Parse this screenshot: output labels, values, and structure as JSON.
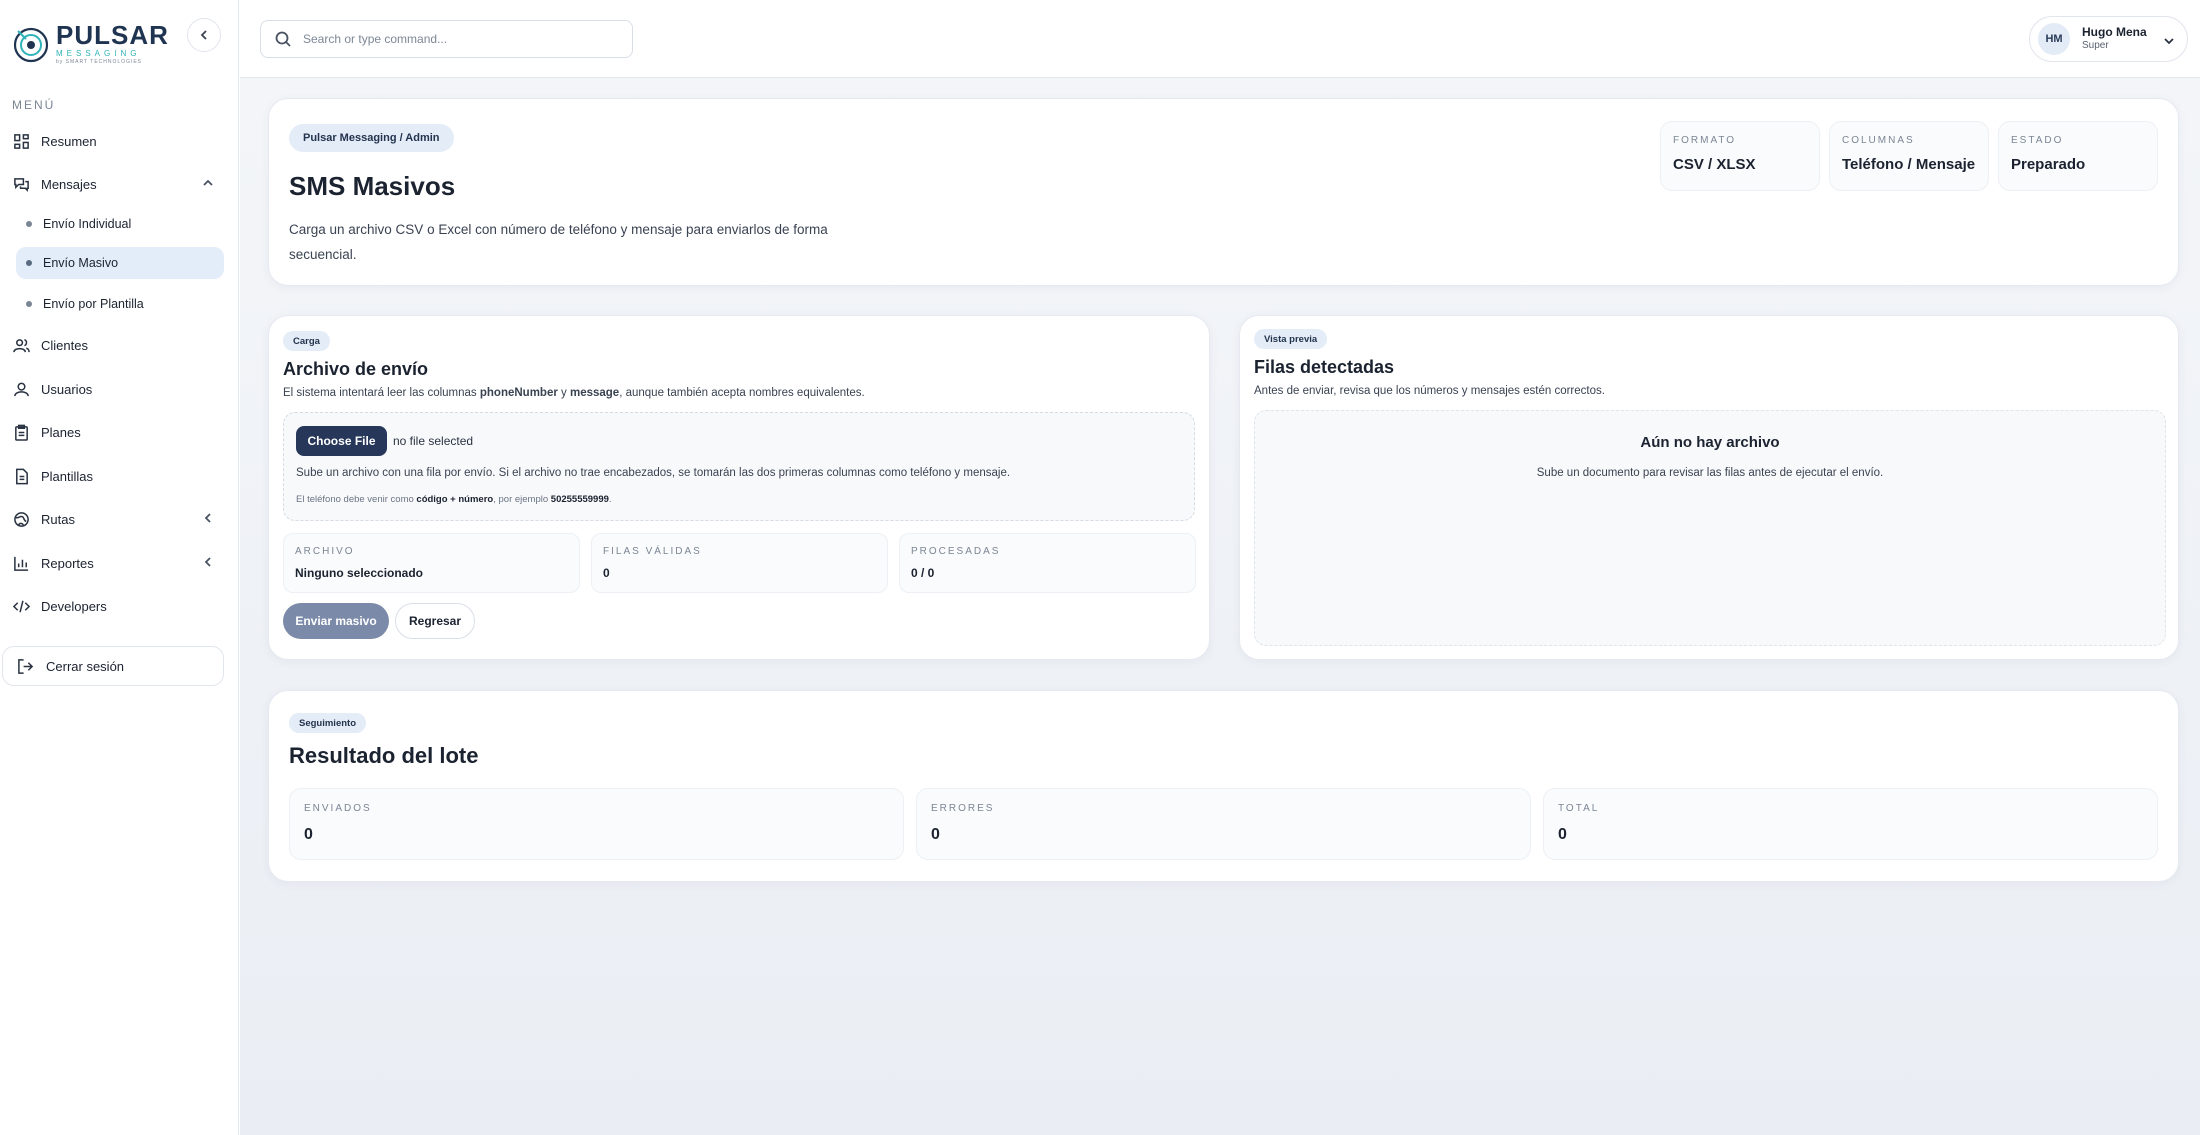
{
  "brand": {
    "name": "PULSAR",
    "sub": "MESSAGING",
    "sub2": "by SMART TECHNOLOGIES"
  },
  "sidebar": {
    "menu_label": "MENÚ",
    "items": [
      {
        "label": "Resumen",
        "icon": "grid-icon"
      },
      {
        "label": "Mensajes",
        "icon": "messages-icon"
      },
      {
        "label": "Clientes",
        "icon": "users-icon"
      },
      {
        "label": "Usuarios",
        "icon": "user-icon"
      },
      {
        "label": "Planes",
        "icon": "clipboard-icon"
      },
      {
        "label": "Plantillas",
        "icon": "document-icon"
      },
      {
        "label": "Rutas",
        "icon": "globe-icon"
      },
      {
        "label": "Reportes",
        "icon": "bar-chart-icon"
      },
      {
        "label": "Developers",
        "icon": "code-icon"
      }
    ],
    "subitems": [
      {
        "label": "Envío Individual"
      },
      {
        "label": "Envío Masivo"
      },
      {
        "label": "Envío por Plantilla"
      }
    ],
    "logout": "Cerrar sesión"
  },
  "topbar": {
    "search_placeholder": "Search or type command...",
    "user": {
      "initials": "HM",
      "name": "Hugo Mena",
      "role": "Super"
    }
  },
  "hero": {
    "breadcrumb": "Pulsar Messaging / Admin",
    "title": "SMS Masivos",
    "description_line1": "Carga un archivo CSV o Excel con número de teléfono y mensaje para enviarlos de forma",
    "description_line2": "secuencial.",
    "stats": [
      {
        "label": "FORMATO",
        "value": "CSV / XLSX"
      },
      {
        "label": "COLUMNAS",
        "value": "Teléfono / Mensaje"
      },
      {
        "label": "ESTADO",
        "value": "Preparado"
      }
    ]
  },
  "upload_card": {
    "tag": "Carga",
    "title": "Archivo de envío",
    "desc_a": "El sistema intentará leer las columnas ",
    "desc_b": "phoneNumber",
    "desc_c": " y ",
    "desc_d": "message",
    "desc_e": ", aunque también acepta nombres equivalentes.",
    "choose_file": "Choose File",
    "no_file": "no file selected",
    "hint1": "Sube un archivo con una fila por envío. Si el archivo no trae encabezados, se tomarán las dos primeras columnas como teléfono y mensaje.",
    "hint2_a": "El teléfono debe venir como ",
    "hint2_b": "código + número",
    "hint2_c": ", por ejemplo ",
    "hint2_d": "50255559999",
    "hint2_e": ".",
    "fields": [
      {
        "label": "ARCHIVO",
        "value": "Ninguno seleccionado"
      },
      {
        "label": "FILAS VÁLIDAS",
        "value": "0"
      },
      {
        "label": "PROCESADAS",
        "value": "0 / 0"
      }
    ],
    "send_button": "Enviar masivo",
    "back_button": "Regresar"
  },
  "preview_card": {
    "tag": "Vista previa",
    "title": "Filas detectadas",
    "desc": "Antes de enviar, revisa que los números y mensajes estén correctos.",
    "empty_title": "Aún no hay archivo",
    "empty_sub": "Sube un documento para revisar las filas antes de ejecutar el envío."
  },
  "result_card": {
    "tag": "Seguimiento",
    "title": "Resultado del lote",
    "stats": [
      {
        "label": "ENVIADOS",
        "value": "0"
      },
      {
        "label": "ERRORES",
        "value": "0"
      },
      {
        "label": "TOTAL",
        "value": "0"
      }
    ]
  },
  "colors": {
    "accent": "#26375a",
    "active_bg": "#e3edf9",
    "teal": "#2fb3b8",
    "disabled_btn": "#7a8aa8"
  }
}
